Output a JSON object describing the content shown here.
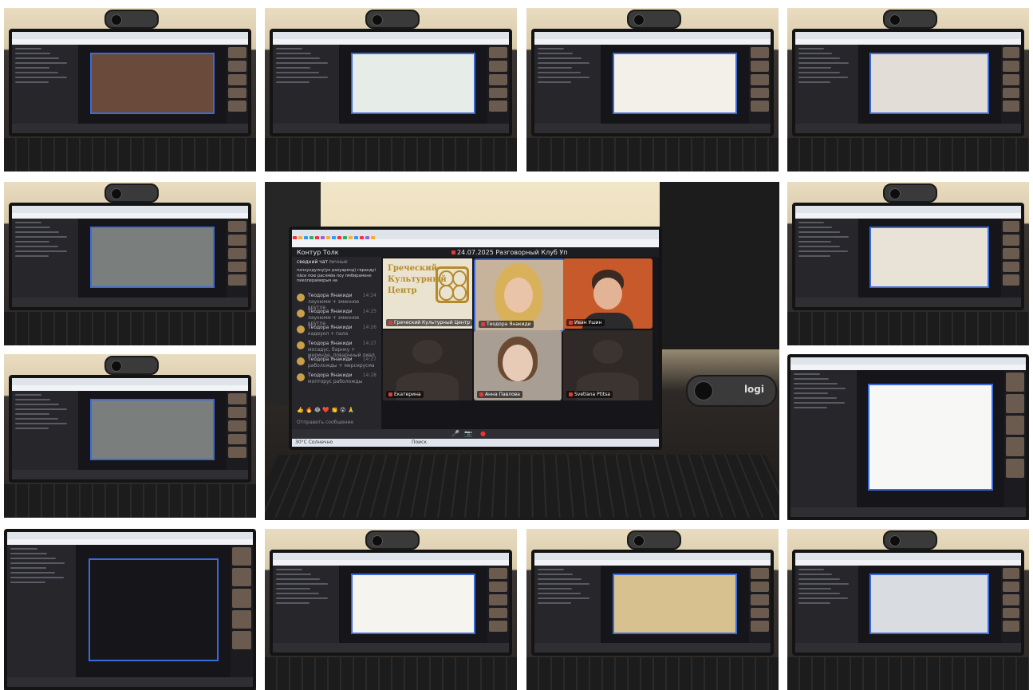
{
  "collage": {
    "tiles": [
      {
        "name": "tile-1",
        "scene": "video-grid-participants"
      },
      {
        "name": "tile-2",
        "scene": "food-product-shared"
      },
      {
        "name": "tile-3",
        "scene": "plated-dish-shared"
      },
      {
        "name": "tile-4",
        "scene": "cooking-hands-shared"
      },
      {
        "name": "tile-5",
        "scene": "pan-cooking-shared"
      },
      {
        "name": "tile-7",
        "scene": "dessert-shared"
      },
      {
        "name": "tile-8",
        "scene": "pan-cooking-shared"
      },
      {
        "name": "tile-9",
        "scene": "document-shared"
      },
      {
        "name": "tile-10",
        "scene": "food-photos-dark"
      },
      {
        "name": "tile-11",
        "scene": "recipe-page-shared"
      },
      {
        "name": "tile-12",
        "scene": "painting-shared"
      },
      {
        "name": "tile-13",
        "scene": "product-box-shared"
      }
    ]
  },
  "center": {
    "app_title": "Контур Толк",
    "meeting_title": "24.07.2025 Разговорный Клуб Уп",
    "chat_tab_all": "сведний чат",
    "chat_tab_private": "личные",
    "chat_top_message": "пачхундулну(ун рахуаренд) герандуі пāси пою раслмйа поу пмбирамене пикоперамюрьм на",
    "chat": [
      {
        "name": "Теодора Янакиди",
        "msg": "лаукюмм + зменное крутла",
        "time": "14:24"
      },
      {
        "name": "Теодора Янакиди",
        "msg": "лаукюмм + зменное крутла",
        "time": "14:25"
      },
      {
        "name": "Теодора Янакиди",
        "msg": "кадеуол + пала",
        "time": "14:26"
      },
      {
        "name": "Теодора Янакиди",
        "msg": "мосадус, барнку + меринде, поварнный лиал",
        "time": "14:27"
      },
      {
        "name": "Теодора Янакиди",
        "msg": "раболожды + мерсирусма",
        "time": "14:27"
      },
      {
        "name": "Теодора Янакиди",
        "msg": "мопторус раболожды",
        "time": "14:28"
      }
    ],
    "chat_input_placeholder": "Отправить сообщение",
    "logo_text": [
      "Греческий",
      "Культурный",
      "Центр"
    ],
    "tile_labels": {
      "logo": "Греческий Культурный Центр",
      "woman": "Теодора Янакиди",
      "man": "Иван Ушин",
      "silhouette_left": "Екатерина",
      "woman2": "Анна Павлова",
      "silhouette_right": "Svetlana Ptitsa"
    },
    "webcam_brand": "logi",
    "taskbar_search": "Поиск",
    "taskbar_user": "30°C Солнечно"
  },
  "colors": {
    "accent_blue": "#3b6bd8",
    "brand_gold": "#b58a2a",
    "app_dark": "#1f1f24"
  }
}
